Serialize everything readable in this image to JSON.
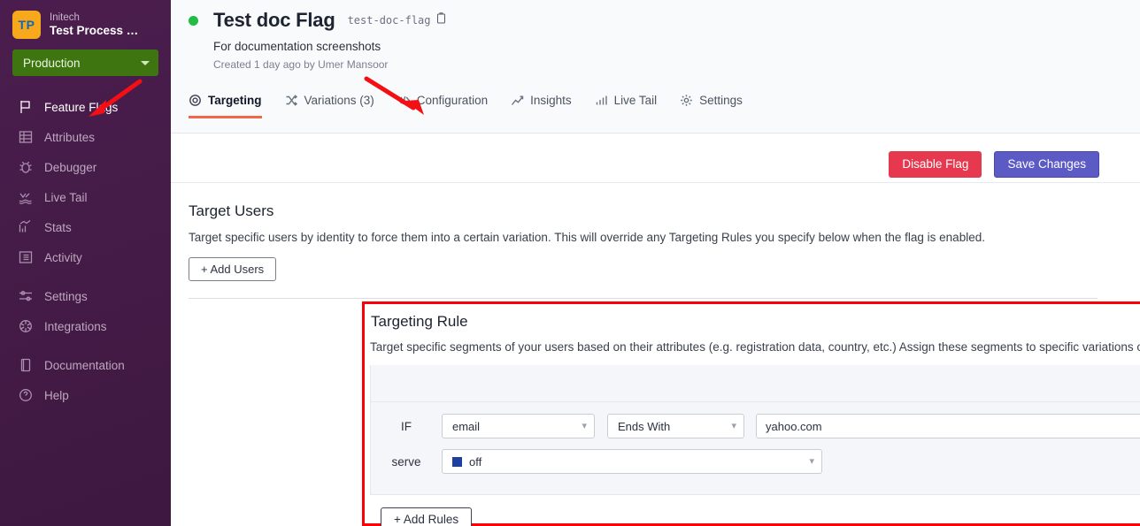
{
  "sidebar": {
    "logo_initials": "TP",
    "org_name": "Initech",
    "project_name": "Test Process …",
    "environment": "Production",
    "items": [
      {
        "label": "Feature Flags",
        "icon": "flag-icon",
        "active": true
      },
      {
        "label": "Attributes",
        "icon": "table-icon",
        "active": false
      },
      {
        "label": "Debugger",
        "icon": "bug-icon",
        "active": false
      },
      {
        "label": "Live Tail",
        "icon": "whale-icon",
        "active": false
      },
      {
        "label": "Stats",
        "icon": "chart-icon",
        "active": false
      },
      {
        "label": "Activity",
        "icon": "list-icon",
        "active": false
      },
      {
        "label": "Settings",
        "icon": "sliders-icon",
        "active": false
      },
      {
        "label": "Integrations",
        "icon": "puzzle-icon",
        "active": false
      },
      {
        "label": "Documentation",
        "icon": "book-icon",
        "active": false
      },
      {
        "label": "Help",
        "icon": "question-circle-icon",
        "active": false
      }
    ]
  },
  "header": {
    "status": "enabled",
    "title": "Test doc Flag",
    "key": "test-doc-flag",
    "description": "For documentation screenshots",
    "meta": "Created 1 day ago by Umer Mansoor"
  },
  "tabs": [
    {
      "label": "Targeting",
      "icon": "target-icon",
      "active": true
    },
    {
      "label": "Variations (3)",
      "icon": "shuffle-icon",
      "active": false
    },
    {
      "label": "Configuration",
      "icon": "code-icon",
      "active": false
    },
    {
      "label": "Insights",
      "icon": "trend-icon",
      "active": false
    },
    {
      "label": "Live Tail",
      "icon": "bars-icon",
      "active": false
    },
    {
      "label": "Settings",
      "icon": "gear-icon",
      "active": false
    }
  ],
  "actions": {
    "disable_label": "Disable Flag",
    "save_label": "Save Changes"
  },
  "target_users": {
    "title": "Target Users",
    "description": "Target specific users by identity to force them into a certain variation. This will override any Targeting Rules you specify below when the flag is enabled.",
    "add_button": "+ Add Users"
  },
  "targeting_rule": {
    "title": "Targeting Rule",
    "description": "Target specific segments of your users based on their attributes (e.g. registration data, country, etc.) Assign these segments to specific variations or use gradual rollout.",
    "if_label": "IF",
    "serve_label": "serve",
    "attribute": "email",
    "operator": "Ends With",
    "value": "yahoo.com",
    "value_placeholder": "yahoo.com",
    "serve_variation": "off",
    "serve_swatch_color": "#1d3fa0",
    "add_condition_label": "+",
    "add_rules_button": "+ Add Rules"
  },
  "colors": {
    "sidebar_bg": "#451c48",
    "env_green": "#3f7511",
    "logo_orange": "#f7a81b",
    "status_green": "#22bb44",
    "danger_red": "#e63950",
    "primary_purple": "#5c5ac4",
    "tab_underline": "#f2674a",
    "annotation_red": "#fb0007"
  }
}
